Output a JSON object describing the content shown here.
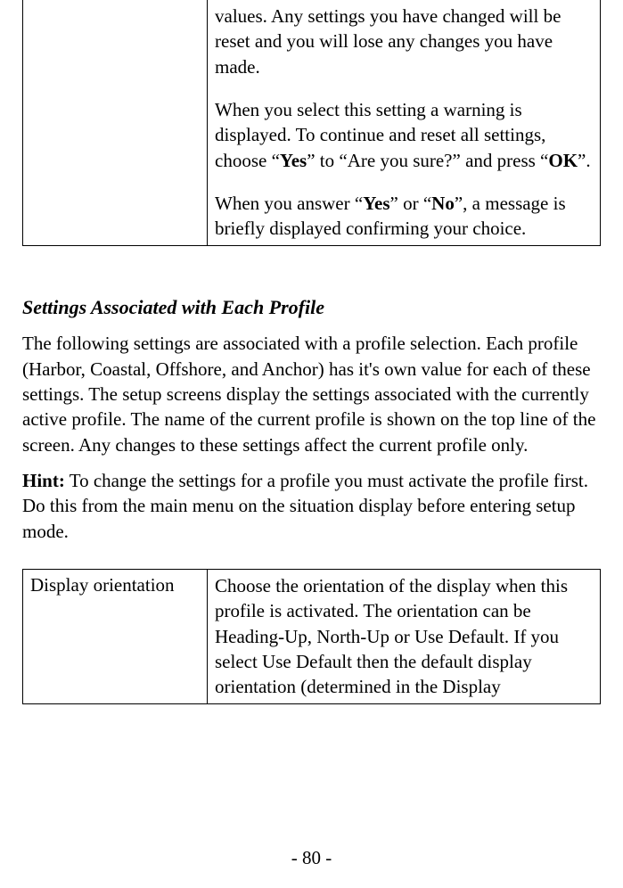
{
  "table1": {
    "cell_p1a": "values. Any settings you have changed will be reset and you will lose any changes you have made.",
    "cell_p2_pre": "When you select this setting a warning is displayed. To continue and reset all settings, choose “",
    "cell_p2_b1": "Yes",
    "cell_p2_mid1": "” to “Are you sure?” and press “",
    "cell_p2_b2": "OK",
    "cell_p2_end": "”.",
    "cell_p3_pre": "When you answer “",
    "cell_p3_b1": "Yes",
    "cell_p3_mid": "” or “",
    "cell_p3_b2": "No",
    "cell_p3_end": "”, a message is briefly displayed confirming your choice."
  },
  "section": {
    "title": "Settings Associated with Each Profile",
    "para1": "The following settings are associated with a profile selection. Each profile (Harbor, Coastal, Offshore, and Anchor) has it's own value for each of these settings. The setup screens display the settings associated with the currently active profile. The name of the current profile is shown on the top line of the screen. Any changes to these settings affect the current profile only.",
    "hint_label": "Hint:",
    "hint_text": " To change the settings for a profile you must activate the profile first. Do this from the main menu on the situation display before entering setup mode."
  },
  "table2": {
    "label": "Display orientation",
    "desc": "Choose the orientation of the display when this profile is activated. The orientation can be Heading-Up, North-Up or Use Default. If you select Use Default then the default display orientation (determined in the Display"
  },
  "page_number": "- 80 -"
}
